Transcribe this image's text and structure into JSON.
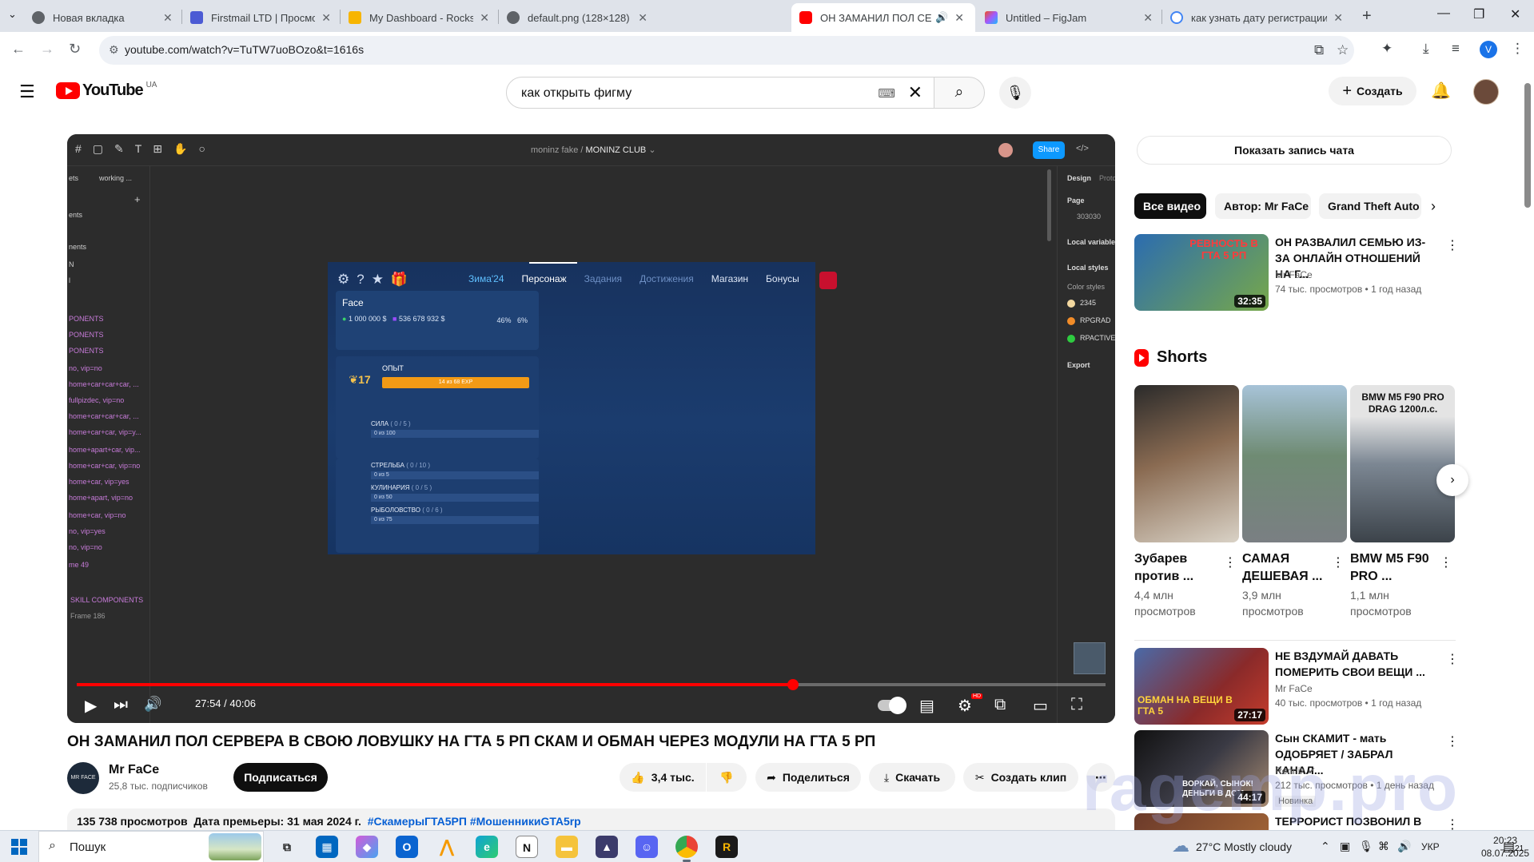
{
  "browser": {
    "tabs": [
      {
        "label": "Новая вкладка",
        "color": "#5f6368",
        "active": false
      },
      {
        "label": "Firstmail LTD | Просмотр сообщения",
        "color": "#4c5bd4",
        "active": false
      },
      {
        "label": "My Dashboard - Rockstar Games",
        "color": "#f7b500",
        "active": false
      },
      {
        "label": "default.png (128×128)",
        "color": "#5f6368",
        "active": false
      },
      {
        "label": "ОН ЗАМАНИЛ ПОЛ СЕРВЕРА",
        "color": "#ff0000",
        "active": true
      },
      {
        "label": "Untitled – FigJam",
        "color": "#a259ff",
        "active": false
      },
      {
        "label": "как узнать дату регистрации рокстар",
        "color": "#4285f4",
        "active": false
      }
    ],
    "url": "youtube.com/watch?v=TuTW7uoBOzo&t=1616s",
    "profile_initial": "V"
  },
  "yt_header": {
    "logo_word": "YouTube",
    "region": "UA",
    "search_value": "как открыть фигму",
    "create_label": "Создать"
  },
  "figma": {
    "breadcrumb_user": "moninz fake",
    "breadcrumb_file": "MONINZ CLUB",
    "share": "Share",
    "left_panel": [
      "ets",
      "working ...",
      "ents",
      "nents",
      "N",
      "l",
      "PONENTS",
      "PONENTS",
      "PONENTS",
      "no, vip=no",
      "home+car+car+car, ...",
      "fullpizdec, vip=no",
      "home+car+car+car, ...",
      "home+car+car, vip=y...",
      "home+apart+car, vip...",
      "home+car+car, vip=no",
      "home+car, vip=yes",
      "home+apart, vip=no",
      "home+car, vip=no",
      "no, vip=yes",
      "no, vip=no",
      "me 49",
      "SKILL COMPONENTS",
      "Frame 186"
    ],
    "right_panel": {
      "tab_design": "Design",
      "tab_proto": "Proto",
      "page": "Page",
      "page_color": "303030",
      "local_variables": "Local variables",
      "local_styles": "Local styles",
      "color_styles": "Color styles",
      "styles": [
        {
          "name": "2345",
          "color": "#f3d8a0"
        },
        {
          "name": "RPGRAD",
          "color": "#f28c28"
        },
        {
          "name": "RPACTIVE",
          "color": "#2ecc40"
        }
      ],
      "export": "Export"
    }
  },
  "game": {
    "tabs": [
      "Зима'24",
      "Персонаж",
      "Задания",
      "Достижения",
      "Магазин",
      "Бонусы"
    ],
    "player_name": "Face",
    "cash": "1 000 000 $",
    "bank": "536 678 932 $",
    "stat1": "46%",
    "stat2": "6%",
    "level": "17",
    "xp_label": "ОПЫТ",
    "xp_text": "14 из 68 EXP",
    "skills": [
      {
        "name": "СИЛА",
        "progress": "( 0 / 5 )",
        "sub": "0 из 100"
      },
      {
        "name": "СТРЕЛЬБА",
        "progress": "( 0 / 10 )",
        "sub": "0 из 5"
      },
      {
        "name": "КУЛИНАРИЯ",
        "progress": "( 0 / 5 )",
        "sub": "0 из 50"
      },
      {
        "name": "РЫБОЛОВСТВО",
        "progress": "( 0 / 6 )",
        "sub": "0 из 75"
      }
    ]
  },
  "player": {
    "current_time": "27:54",
    "duration": "40:06",
    "progress_fraction": 0.696,
    "hd_badge": "HD"
  },
  "video": {
    "title": "ОН ЗАМАНИЛ ПОЛ СЕРВЕРА В СВОЮ ЛОВУШКУ НА ГТА 5 РП СКАМ И ОБМАН ЧЕРЕЗ МОДУЛИ НА ГТА 5 РП",
    "channel": "Mr FaCe",
    "channel_avatar_text": "MR FACE",
    "subscribers": "25,8 тыс. подписчиков",
    "subscribe": "Подписаться",
    "likes": "3,4 тыс.",
    "share": "Поделиться",
    "download": "Скачать",
    "clip": "Создать клип",
    "views": "135 738 просмотров",
    "premiere": "Дата премьеры: 31 мая 2024 г.",
    "tags": "#СкамерыГТА5РП #МошенникиGTA5rp"
  },
  "sidebar": {
    "chat_replay": "Показать запись чата",
    "chips": [
      "Все видео",
      "Автор: Mr FaCe",
      "Grand Theft Auto"
    ],
    "recs": [
      {
        "title": "ОН РАЗВАЛИЛ СЕМЬЮ ИЗ-ЗА ОНЛАЙН ОТНОШЕНИЙ НА Г...",
        "channel": "Mr FaCe",
        "meta": "74 тыс. просмотров • 1 год назад",
        "duration": "32:35",
        "thumb_text": "РЕВНОСТЬ В ГТА 5 РП",
        "thumb_color": "#3a6ea8"
      },
      {
        "title": "НЕ ВЗДУМАЙ ДАВАТЬ ПОМЕРИТЬ СВОИ ВЕЩИ ...",
        "channel": "Mr FaCe",
        "meta": "40 тыс. просмотров • 1 год назад",
        "duration": "27:17",
        "thumb_text": "ОБМАН НА ВЕЩИ В ГТА 5",
        "thumb_color": "#8a2a2a"
      },
      {
        "title": "Сын СКАМИТ - мать ОДОБРЯЕТ / ЗАБРАЛ КАНАЛ...",
        "channel": "Rennix",
        "meta": "212 тыс. просмотров • 1 день назад",
        "duration": "44:17",
        "badge": "Новинка",
        "thumb_text": "ВОРКАЙ, СЫНОК! ДЕНЬГИ В ДОМ",
        "thumb_color": "#1e1e24"
      },
      {
        "title": "ТЕРРОРИСТ ПОЗВОНИЛ В",
        "channel": "",
        "meta": "",
        "duration": "",
        "thumb_text": "",
        "thumb_color": "#6b3a2a"
      }
    ],
    "shorts_title": "Shorts",
    "shorts": [
      {
        "title": "Зубарев против ...",
        "views": "4,4 млн просмотров",
        "color": "#5a4a3e",
        "overlay": ""
      },
      {
        "title": "САМАЯ ДЕШЕВАЯ ...",
        "views": "3,9 млн просмотров",
        "color": "#6f7f72",
        "overlay": ""
      },
      {
        "title": "BMW M5 F90 PRO ...",
        "views": "1,1 млн просмотров",
        "color": "#5d6670",
        "overlay": "BMW M5 F90 PRO DRAG 1200л.с."
      }
    ]
  },
  "watermark": "ragemp.pro",
  "taskbar": {
    "search_placeholder": "Пошук",
    "weather": "27°C Mostly cloudy",
    "lang": "УКР",
    "time": "20:23",
    "date": "08.07.2025",
    "notif_count": "21"
  }
}
